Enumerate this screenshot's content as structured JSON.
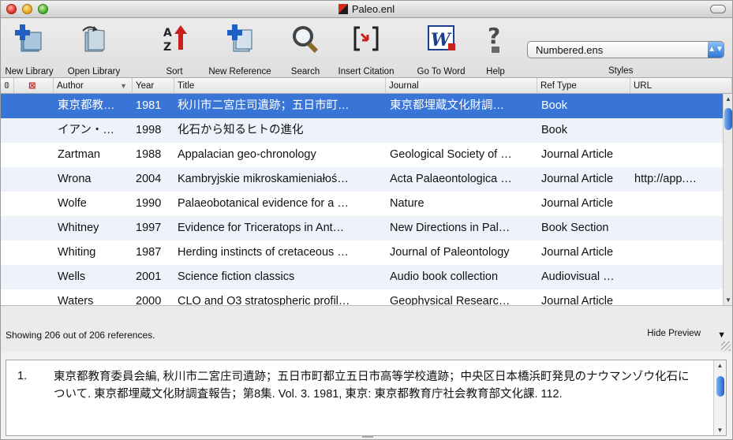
{
  "window": {
    "title": "Paleo.enl"
  },
  "toolbar": [
    {
      "label": "New Library",
      "icon": "new-library-icon"
    },
    {
      "label": "Open Library",
      "icon": "open-library-icon"
    },
    {
      "label": "Sort",
      "icon": "sort-icon"
    },
    {
      "label": "New Reference",
      "icon": "new-reference-icon"
    },
    {
      "label": "Search",
      "icon": "search-icon"
    },
    {
      "label": "Insert Citation",
      "icon": "insert-citation-icon"
    },
    {
      "label": "Go To Word",
      "icon": "word-icon"
    },
    {
      "label": "Help",
      "icon": "help-icon"
    }
  ],
  "styles": {
    "selected": "Numbered.ens",
    "label": "Styles"
  },
  "columns": {
    "author": "Author",
    "year": "Year",
    "title": "Title",
    "journal": "Journal",
    "reftype": "Ref Type",
    "url": "URL"
  },
  "references": [
    {
      "author": "東京都教…",
      "year": "1981",
      "title": "秋川市二宮庄司遺跡；五日市町…",
      "journal": "東京都埋蔵文化財調…",
      "reftype": "Book",
      "url": ""
    },
    {
      "author": "イアン・…",
      "year": "1998",
      "title": "化石から知るヒトの進化",
      "journal": "",
      "reftype": "Book",
      "url": ""
    },
    {
      "author": "Zartman",
      "year": "1988",
      "title": "Appalacian geo-chronology",
      "journal": "Geological Society of …",
      "reftype": "Journal Article",
      "url": ""
    },
    {
      "author": "Wrona",
      "year": "2004",
      "title": "Kambryjskie mikroskamieniałoś…",
      "journal": "Acta Palaeontologica …",
      "reftype": "Journal Article",
      "url": "http://app.…"
    },
    {
      "author": "Wolfe",
      "year": "1990",
      "title": "Palaeobotanical evidence for a …",
      "journal": "Nature",
      "reftype": "Journal Article",
      "url": ""
    },
    {
      "author": "Whitney",
      "year": "1997",
      "title": "Evidence for Triceratops in Ant…",
      "journal": "New Directions in Pal…",
      "reftype": "Book Section",
      "url": ""
    },
    {
      "author": "Whiting",
      "year": "1987",
      "title": "Herding instincts of cretaceous …",
      "journal": "Journal of Paleontology",
      "reftype": "Journal Article",
      "url": ""
    },
    {
      "author": "Wells",
      "year": "2001",
      "title": "Science fiction classics",
      "journal": "Audio book collection",
      "reftype": "Audiovisual …",
      "url": ""
    },
    {
      "author": "Waters",
      "year": "2000",
      "title": "CLO and O3 stratospheric profil…",
      "journal": "Geophysical Researc…",
      "reftype": "Journal Article",
      "url": ""
    }
  ],
  "status": {
    "text": "Showing 206 out of 206 references.",
    "hide_preview": "Hide Preview"
  },
  "preview": {
    "number": "1.",
    "text": "東京都教育委員会編, 秋川市二宮庄司遺跡；五日市町都立五日市高等学校遺跡；中央区日本橋浜町発見のナウマンゾウ化石について. 東京都埋蔵文化財調査報告；第8集. Vol. 3. 1981, 東京: 東京都教育庁社会教育部文化課. 112."
  },
  "colors": {
    "selection": "#3875d7",
    "alt_row": "#eef2fb"
  }
}
